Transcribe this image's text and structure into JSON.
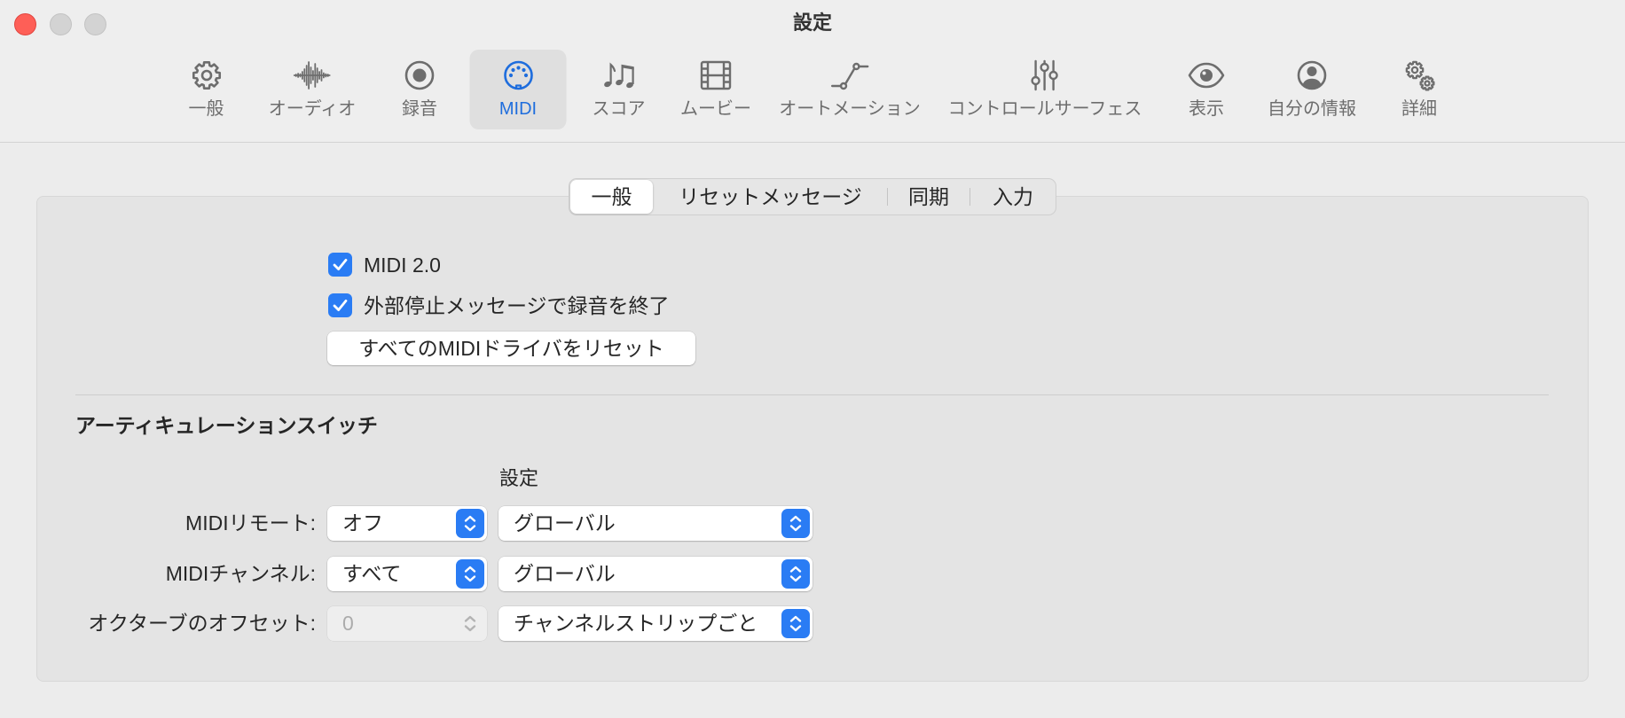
{
  "window": {
    "title": "設定"
  },
  "toolbar": {
    "items": [
      {
        "label": "一般",
        "icon": "gear-icon"
      },
      {
        "label": "オーディオ",
        "icon": "waveform-icon"
      },
      {
        "label": "録音",
        "icon": "record-icon"
      },
      {
        "label": "MIDI",
        "icon": "midi-connector-icon",
        "selected": true
      },
      {
        "label": "スコア",
        "icon": "music-notes-icon"
      },
      {
        "label": "ムービー",
        "icon": "film-icon"
      },
      {
        "label": "オートメーション",
        "icon": "automation-icon"
      },
      {
        "label": "コントロールサーフェス",
        "icon": "sliders-icon"
      },
      {
        "label": "表示",
        "icon": "eye-icon"
      },
      {
        "label": "自分の情報",
        "icon": "person-circle-icon"
      },
      {
        "label": "詳細",
        "icon": "gears-icon"
      }
    ]
  },
  "tabs": {
    "items": [
      {
        "label": "一般",
        "selected": true
      },
      {
        "label": "リセットメッセージ"
      },
      {
        "label": "同期"
      },
      {
        "label": "入力"
      }
    ]
  },
  "general": {
    "midi2_checkbox": {
      "label": "MIDI 2.0",
      "checked": true
    },
    "stop_recording_checkbox": {
      "label": "外部停止メッセージで録音を終了",
      "checked": true
    },
    "reset_button": "すべてのMIDIドライバをリセット"
  },
  "articulation": {
    "heading": "アーティキュレーションスイッチ",
    "column_header": "設定",
    "rows": [
      {
        "label": "MIDIリモート:",
        "value": "オフ",
        "setting": "グローバル"
      },
      {
        "label": "MIDIチャンネル:",
        "value": "すべて",
        "setting": "グローバル"
      },
      {
        "label": "オクターブのオフセット:",
        "value": "0",
        "value_disabled": true,
        "setting": "チャンネルストリップごと"
      }
    ]
  },
  "colors": {
    "accent": "#1e6ddd",
    "control_accent": "#2a7cf4",
    "close_button": "#fe5f57"
  }
}
